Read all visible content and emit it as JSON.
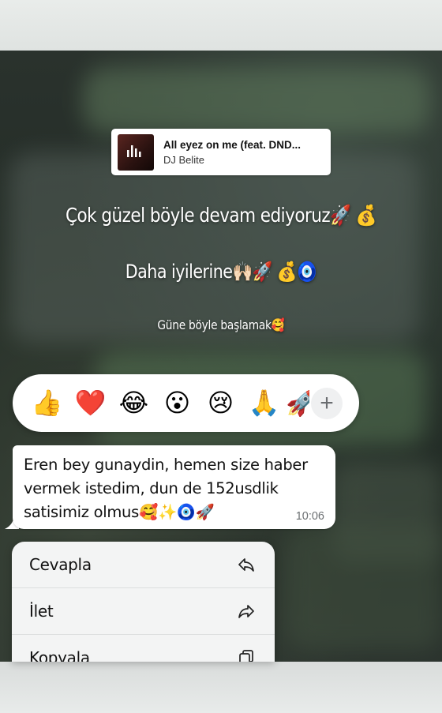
{
  "music": {
    "title": "All eyez on me (feat. DND...",
    "artist": "DJ Belite"
  },
  "captions": [
    "Çok güzel böyle devam ediyoruz🚀 💰",
    "Daha iyilerine🙌🏻🚀 💰🧿",
    "Güne böyle başlamak🥰"
  ],
  "reactions": [
    "👍",
    "❤️",
    "😂",
    "😮",
    "😢",
    "🙏",
    "🚀"
  ],
  "reaction_add_label": "+",
  "message": {
    "text": "Eren bey gunaydin, hemen size haber vermek istedim, dun de 152usdlik satisimiz olmus🥰✨🧿🚀",
    "time": "10:06"
  },
  "context_menu": {
    "items": [
      {
        "label": "Cevapla",
        "icon": "reply-icon"
      },
      {
        "label": "İlet",
        "icon": "forward-icon"
      },
      {
        "label": "Kopyala",
        "icon": "copy-icon"
      }
    ]
  }
}
